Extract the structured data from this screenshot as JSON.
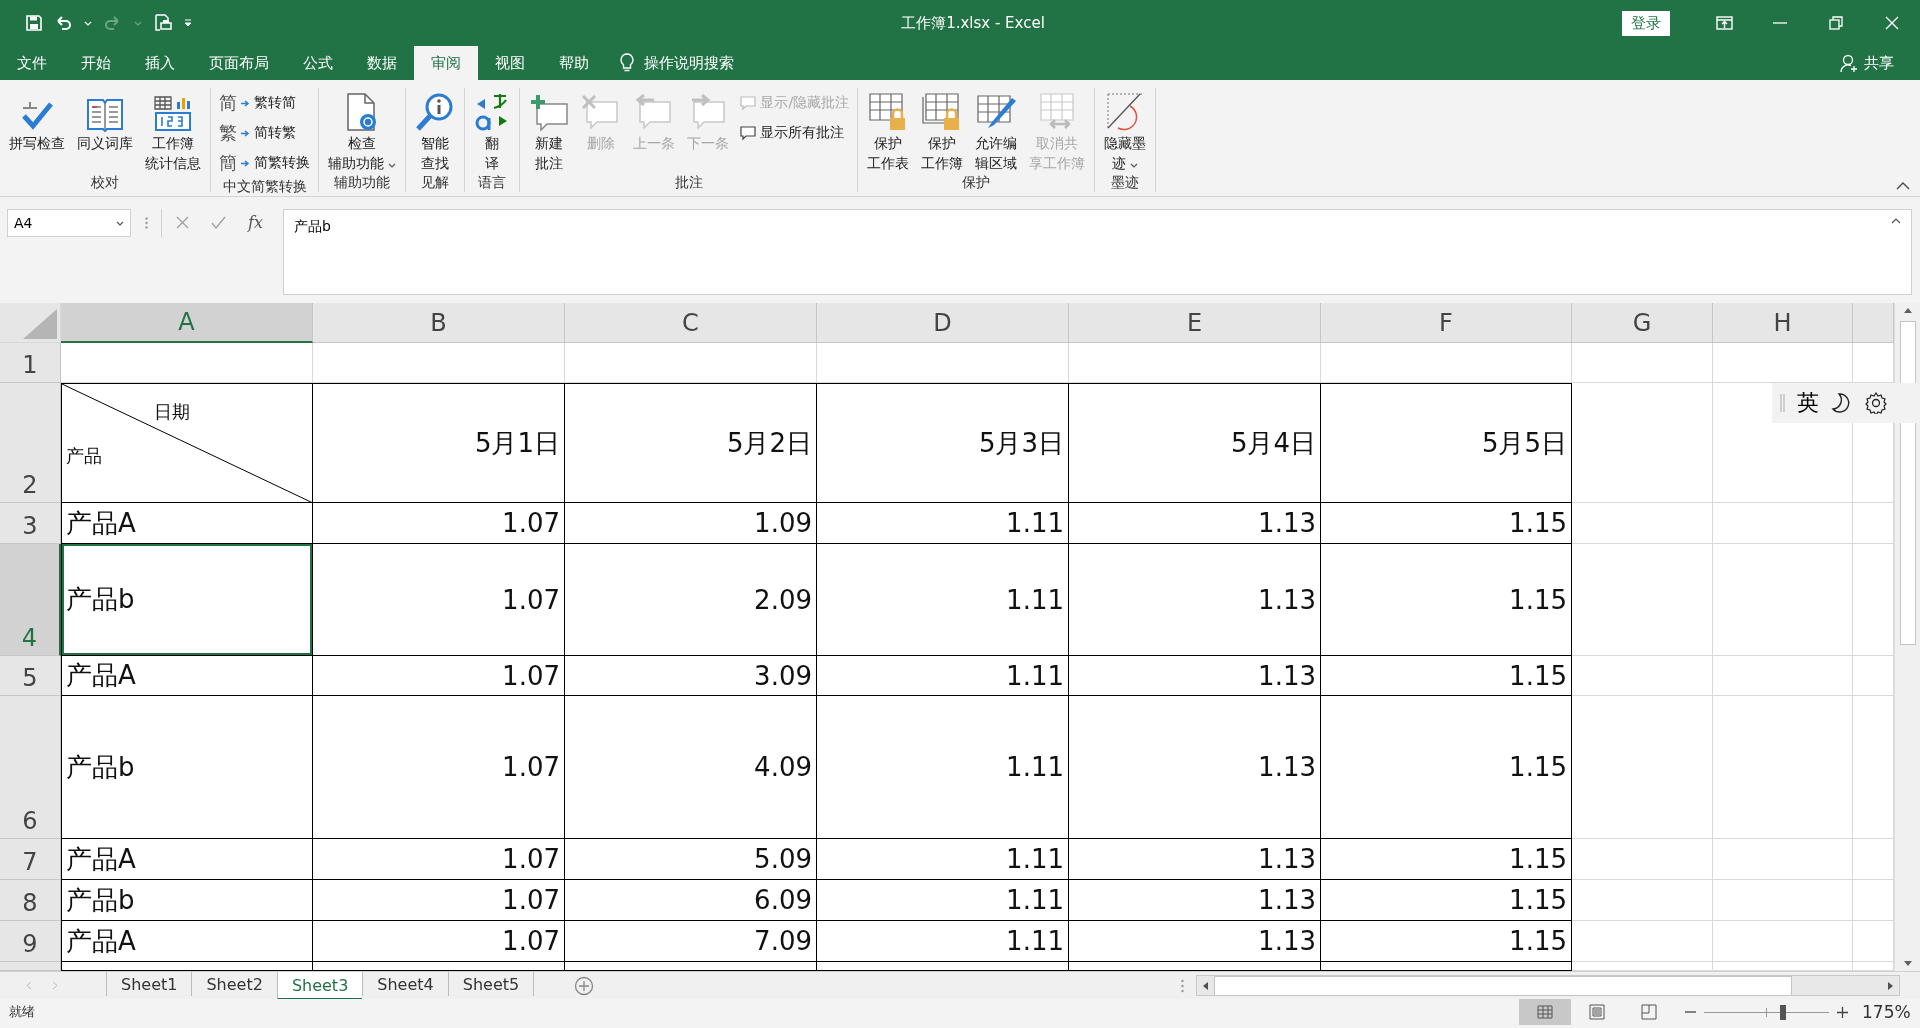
{
  "window": {
    "title": "工作簿1.xlsx  -  Excel",
    "sign_in": "登录"
  },
  "tabs": [
    {
      "label": "文件",
      "selected": false
    },
    {
      "label": "开始",
      "selected": false
    },
    {
      "label": "插入",
      "selected": false
    },
    {
      "label": "页面布局",
      "selected": false
    },
    {
      "label": "公式",
      "selected": false
    },
    {
      "label": "数据",
      "selected": false
    },
    {
      "label": "审阅",
      "selected": true
    },
    {
      "label": "视图",
      "selected": false
    },
    {
      "label": "帮助",
      "selected": false
    }
  ],
  "tell_me": "操作说明搜索",
  "share": "共享",
  "ribbon": {
    "groups": [
      {
        "label": "校对",
        "buttons": [
          {
            "kind": "large",
            "lines": [
              "拼写检查"
            ],
            "disabled": false,
            "dropdown": false
          },
          {
            "kind": "large",
            "lines": [
              "同义词库"
            ],
            "disabled": false,
            "dropdown": false
          },
          {
            "kind": "large",
            "lines": [
              "工作簿",
              "统计信息"
            ],
            "disabled": false,
            "dropdown": false
          }
        ]
      },
      {
        "label": "中文简繁转换",
        "buttons": [
          {
            "kind": "small",
            "icon_text": "简",
            "label": "繁转简",
            "disabled": false,
            "dropdown": false
          },
          {
            "kind": "small",
            "icon_text": "繁",
            "label": "简转繁",
            "disabled": false,
            "dropdown": false
          },
          {
            "kind": "small",
            "icon_text": "簡",
            "label": "简繁转换",
            "disabled": false,
            "dropdown": false
          }
        ]
      },
      {
        "label": "辅助功能",
        "buttons": [
          {
            "kind": "large",
            "lines": [
              "检查",
              "辅助功能"
            ],
            "disabled": false,
            "dropdown": true
          }
        ]
      },
      {
        "label": "见解",
        "buttons": [
          {
            "kind": "large",
            "lines": [
              "智能",
              "查找"
            ],
            "disabled": false,
            "dropdown": false
          }
        ]
      },
      {
        "label": "语言",
        "buttons": [
          {
            "kind": "large",
            "lines": [
              "翻",
              "译"
            ],
            "disabled": false,
            "dropdown": false
          }
        ]
      },
      {
        "label": "批注",
        "buttons": [
          {
            "kind": "large",
            "lines": [
              "新建",
              "批注"
            ],
            "disabled": false,
            "dropdown": false
          },
          {
            "kind": "large",
            "lines": [
              "删除"
            ],
            "disabled": true,
            "dropdown": false
          },
          {
            "kind": "large",
            "lines": [
              "上一条"
            ],
            "disabled": true,
            "dropdown": false
          },
          {
            "kind": "large",
            "lines": [
              "下一条"
            ],
            "disabled": true,
            "dropdown": false
          },
          {
            "kind": "small",
            "label": "显示/隐藏批注",
            "disabled": true,
            "dropdown": false
          },
          {
            "kind": "small",
            "label": "显示所有批注",
            "disabled": false,
            "dropdown": false
          }
        ]
      },
      {
        "label": "保护",
        "buttons": [
          {
            "kind": "large",
            "lines": [
              "保护",
              "工作表"
            ],
            "disabled": false,
            "dropdown": false
          },
          {
            "kind": "large",
            "lines": [
              "保护",
              "工作簿"
            ],
            "disabled": false,
            "dropdown": false
          },
          {
            "kind": "large",
            "lines": [
              "允许编",
              "辑区域"
            ],
            "disabled": false,
            "dropdown": false
          },
          {
            "kind": "large",
            "lines": [
              "取消共",
              "享工作簿"
            ],
            "disabled": true,
            "dropdown": false
          }
        ]
      },
      {
        "label": "墨迹",
        "buttons": [
          {
            "kind": "large",
            "lines": [
              "隐藏墨",
              "迹"
            ],
            "disabled": false,
            "dropdown": true
          }
        ]
      }
    ]
  },
  "formula_bar": {
    "name_box": "A4",
    "function_label": "fx",
    "formula": "产品b"
  },
  "sheet": {
    "columns": [
      {
        "label": "A",
        "selected": true
      },
      {
        "label": "B",
        "selected": false
      },
      {
        "label": "C",
        "selected": false
      },
      {
        "label": "D",
        "selected": false
      },
      {
        "label": "E",
        "selected": false
      },
      {
        "label": "F",
        "selected": false
      },
      {
        "label": "G",
        "selected": false
      },
      {
        "label": "H",
        "selected": false
      }
    ],
    "rows": [
      {
        "header": "1",
        "selected": false,
        "cells": []
      },
      {
        "header": "2",
        "selected": false,
        "cells": [
          {
            "kind": "diagonal",
            "top": "日期",
            "bottom": "产品"
          },
          {
            "kind": "number",
            "value": "5月1日"
          },
          {
            "kind": "number",
            "value": "5月2日"
          },
          {
            "kind": "number",
            "value": "5月3日"
          },
          {
            "kind": "number",
            "value": "5月4日"
          },
          {
            "kind": "number",
            "value": "5月5日"
          }
        ]
      },
      {
        "header": "3",
        "selected": false,
        "cells": [
          {
            "kind": "text",
            "value": "产品A"
          },
          {
            "kind": "number",
            "value": "1.07"
          },
          {
            "kind": "number",
            "value": "1.09"
          },
          {
            "kind": "number",
            "value": "1.11"
          },
          {
            "kind": "number",
            "value": "1.13"
          },
          {
            "kind": "number",
            "value": "1.15"
          }
        ]
      },
      {
        "header": "4",
        "selected": true,
        "cells": [
          {
            "kind": "text",
            "value": "产品b"
          },
          {
            "kind": "number",
            "value": "1.07"
          },
          {
            "kind": "number",
            "value": "2.09"
          },
          {
            "kind": "number",
            "value": "1.11"
          },
          {
            "kind": "number",
            "value": "1.13"
          },
          {
            "kind": "number",
            "value": "1.15"
          }
        ]
      },
      {
        "header": "5",
        "selected": false,
        "cells": [
          {
            "kind": "text",
            "value": "产品A"
          },
          {
            "kind": "number",
            "value": "1.07"
          },
          {
            "kind": "number",
            "value": "3.09"
          },
          {
            "kind": "number",
            "value": "1.11"
          },
          {
            "kind": "number",
            "value": "1.13"
          },
          {
            "kind": "number",
            "value": "1.15"
          }
        ]
      },
      {
        "header": "6",
        "selected": false,
        "cells": [
          {
            "kind": "text",
            "value": "产品b"
          },
          {
            "kind": "number",
            "value": "1.07"
          },
          {
            "kind": "number",
            "value": "4.09"
          },
          {
            "kind": "number",
            "value": "1.11"
          },
          {
            "kind": "number",
            "value": "1.13"
          },
          {
            "kind": "number",
            "value": "1.15"
          }
        ]
      },
      {
        "header": "7",
        "selected": false,
        "cells": [
          {
            "kind": "text",
            "value": "产品A"
          },
          {
            "kind": "number",
            "value": "1.07"
          },
          {
            "kind": "number",
            "value": "5.09"
          },
          {
            "kind": "number",
            "value": "1.11"
          },
          {
            "kind": "number",
            "value": "1.13"
          },
          {
            "kind": "number",
            "value": "1.15"
          }
        ]
      },
      {
        "header": "8",
        "selected": false,
        "cells": [
          {
            "kind": "text",
            "value": "产品b"
          },
          {
            "kind": "number",
            "value": "1.07"
          },
          {
            "kind": "number",
            "value": "6.09"
          },
          {
            "kind": "number",
            "value": "1.11"
          },
          {
            "kind": "number",
            "value": "1.13"
          },
          {
            "kind": "number",
            "value": "1.15"
          }
        ]
      },
      {
        "header": "9",
        "selected": false,
        "cells": [
          {
            "kind": "text",
            "value": "产品A"
          },
          {
            "kind": "number",
            "value": "1.07"
          },
          {
            "kind": "number",
            "value": "7.09"
          },
          {
            "kind": "number",
            "value": "1.11"
          },
          {
            "kind": "number",
            "value": "1.13"
          },
          {
            "kind": "number",
            "value": "1.15"
          }
        ]
      }
    ]
  },
  "ime_toolbar": {
    "mode": "英"
  },
  "sheet_tabs": [
    {
      "label": "Sheet1",
      "selected": false
    },
    {
      "label": "Sheet2",
      "selected": false
    },
    {
      "label": "Sheet3",
      "selected": true
    },
    {
      "label": "Sheet4",
      "selected": false
    },
    {
      "label": "Sheet5",
      "selected": false
    }
  ],
  "status_bar": {
    "status": "就绪",
    "views": [
      {
        "selected": true
      },
      {
        "selected": false
      },
      {
        "selected": false
      }
    ],
    "zoom": {
      "level": 0.63,
      "reading": "175%"
    }
  }
}
